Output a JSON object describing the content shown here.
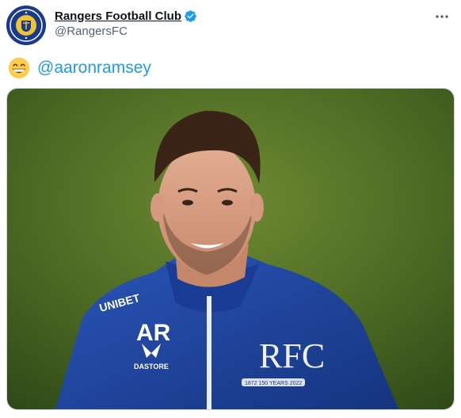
{
  "tweet": {
    "author": {
      "display_name": "Rangers Football Club",
      "handle": "@RangersFC",
      "verified": true,
      "avatar_icon": "rangers-crest-icon"
    },
    "more_icon": "more-icon",
    "text": {
      "emoji": "😁",
      "mention": "@aaronramsey"
    },
    "media": {
      "type": "photo",
      "shirt_text": {
        "sponsor": "UNIBET",
        "initials": "AR",
        "brand": "DASTORE",
        "crest_banner": "1872  150 YEARS  2022"
      }
    }
  },
  "colors": {
    "link": "#1d9bf0",
    "verified": "#1d9bf0",
    "rangers_blue": "#1b3a8f",
    "secondary_text": "#536471"
  }
}
